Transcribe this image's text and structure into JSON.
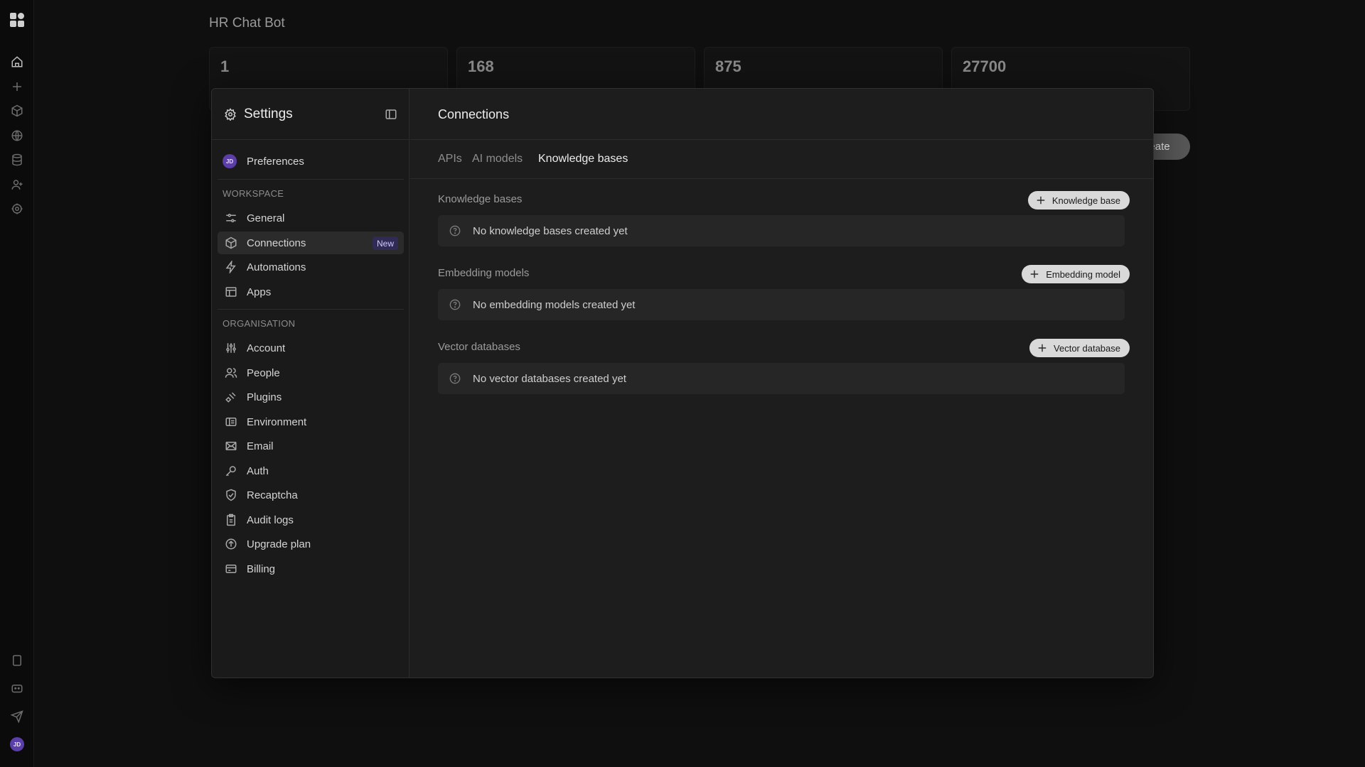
{
  "app": {
    "title": "HR Chat Bot"
  },
  "rail": {
    "icons": [
      "logo-icon",
      "home-icon",
      "plus-icon",
      "cube-icon",
      "globe-icon",
      "database-icon",
      "user-add-icon",
      "gear-icon"
    ],
    "bottom_icons": [
      "book-icon",
      "chat-bot-icon",
      "send-icon"
    ],
    "avatar": "JD"
  },
  "stats": [
    {
      "value": "1"
    },
    {
      "value": "168"
    },
    {
      "value": "875"
    },
    {
      "value": "27700"
    }
  ],
  "background_button": {
    "label": "eate"
  },
  "settings": {
    "title": "Settings",
    "preferences": {
      "avatar": "JD",
      "label": "Preferences"
    },
    "workspace": {
      "heading": "WORKSPACE",
      "items": [
        {
          "label": "General",
          "icon": "sliders-icon"
        },
        {
          "label": "Connections",
          "icon": "cube-icon",
          "badge": "New",
          "active": true
        },
        {
          "label": "Automations",
          "icon": "automation-icon"
        },
        {
          "label": "Apps",
          "icon": "layout-icon"
        }
      ]
    },
    "organisation": {
      "heading": "ORGANISATION",
      "items": [
        {
          "label": "Account",
          "icon": "adjustments-icon"
        },
        {
          "label": "People",
          "icon": "users-icon"
        },
        {
          "label": "Plugins",
          "icon": "plug-icon"
        },
        {
          "label": "Environment",
          "icon": "environment-icon"
        },
        {
          "label": "Email",
          "icon": "mail-icon"
        },
        {
          "label": "Auth",
          "icon": "key-icon"
        },
        {
          "label": "Recaptcha",
          "icon": "shield-check-icon"
        },
        {
          "label": "Audit logs",
          "icon": "clipboard-icon"
        },
        {
          "label": "Upgrade plan",
          "icon": "arrow-up-circle-icon"
        },
        {
          "label": "Billing",
          "icon": "credit-card-icon"
        }
      ]
    }
  },
  "main": {
    "title": "Connections",
    "tabs": [
      {
        "label": "APIs",
        "active": false
      },
      {
        "label": "AI models",
        "active": false
      },
      {
        "label": "Knowledge bases",
        "active": true
      }
    ],
    "groups": [
      {
        "title": "Knowledge bases",
        "button": "Knowledge base",
        "empty": "No knowledge bases created yet"
      },
      {
        "title": "Embedding models",
        "button": "Embedding model",
        "empty": "No embedding models created yet"
      },
      {
        "title": "Vector databases",
        "button": "Vector database",
        "empty": "No vector databases created yet"
      }
    ]
  },
  "colors": {
    "background": "#0f0f0f",
    "modal": "#1d1d1d",
    "badge": "#2f2b55",
    "avatar": "#5b3ea8",
    "button": "#d9d9d9"
  }
}
